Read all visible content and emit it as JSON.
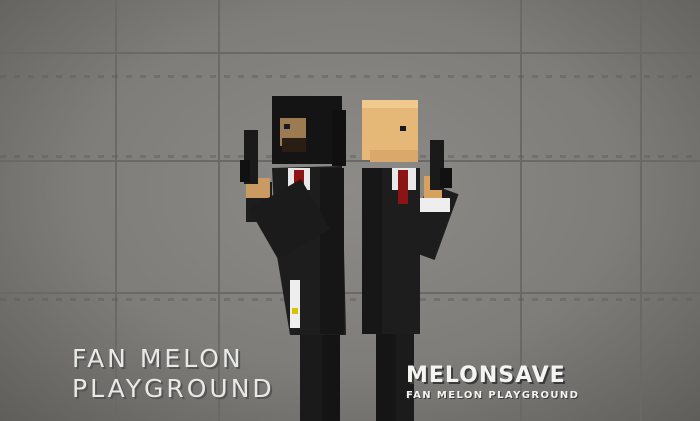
{
  "scene": {
    "background_color": "#7d7c79",
    "left_character": {
      "hair_color": "#141414",
      "suit_color": "#1d1d1d",
      "tie_color": "#8c1414",
      "holding": "pistol-icon"
    },
    "right_character": {
      "head_color": "#e6b878",
      "suit_color": "#1d1d1d",
      "tie_color": "#8c1414",
      "holding": "pistol-icon"
    }
  },
  "title": {
    "line1": "FAN MELON",
    "line2": "PLAYGROUND"
  },
  "brand": {
    "name": "MELONSAVE",
    "subtitle": "FAN MELON PLAYGROUND"
  }
}
